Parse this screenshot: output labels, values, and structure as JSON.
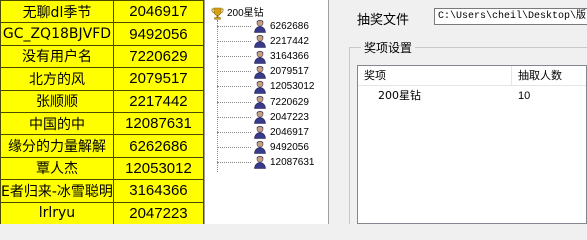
{
  "grid": {
    "rows": [
      [
        "无聊dl季节",
        "2046917"
      ],
      [
        "GC_ZQ18BJVFD",
        "9492056"
      ],
      [
        "没有用户名",
        "7220629"
      ],
      [
        "北方的风",
        "2079517"
      ],
      [
        "张顺顺",
        "2217442"
      ],
      [
        "中国的中",
        "12087631"
      ],
      [
        "缘分的力量解解",
        "6262686"
      ],
      [
        "覃人杰",
        "12053012"
      ],
      [
        "E者归来-冰雪聪明",
        "3164366"
      ],
      [
        "lrlryu",
        "2047223"
      ]
    ]
  },
  "tree": {
    "root": "200星钻",
    "children": [
      "6262686",
      "2217442",
      "3164366",
      "2079517",
      "12053012",
      "7220629",
      "2047223",
      "2046917",
      "9492056",
      "12087631"
    ]
  },
  "settings": {
    "file_label": "抽奖文件",
    "file_path": "C:\\Users\\cheil\\Desktop\\版",
    "group_title": "奖项设置",
    "columns": [
      "奖项",
      "抽取人数"
    ],
    "rows": [
      {
        "prize": "200星钻",
        "count": "10"
      }
    ]
  }
}
